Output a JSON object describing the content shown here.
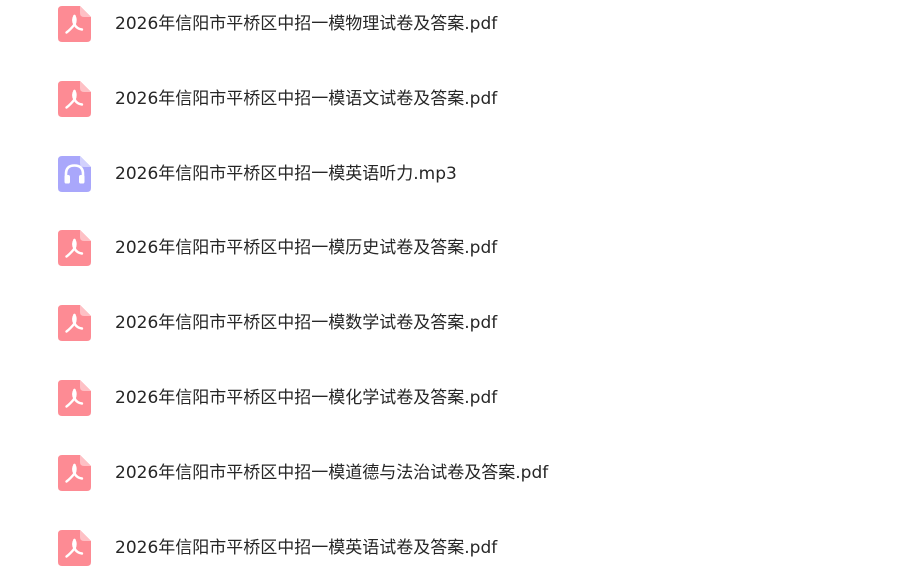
{
  "colors": {
    "pdf_icon": "#fd8b94",
    "audio_icon": "#a9a7fb",
    "text": "#262626",
    "background": "#ffffff"
  },
  "files": [
    {
      "name": "2026年信阳市平桥区中招一模物理试卷及答案.pdf",
      "type": "pdf",
      "icon": "pdf-icon"
    },
    {
      "name": "2026年信阳市平桥区中招一模语文试卷及答案.pdf",
      "type": "pdf",
      "icon": "pdf-icon"
    },
    {
      "name": "2026年信阳市平桥区中招一模英语听力.mp3",
      "type": "mp3",
      "icon": "headphones-icon"
    },
    {
      "name": "2026年信阳市平桥区中招一模历史试卷及答案.pdf",
      "type": "pdf",
      "icon": "pdf-icon"
    },
    {
      "name": "2026年信阳市平桥区中招一模数学试卷及答案.pdf",
      "type": "pdf",
      "icon": "pdf-icon"
    },
    {
      "name": "2026年信阳市平桥区中招一模化学试卷及答案.pdf",
      "type": "pdf",
      "icon": "pdf-icon"
    },
    {
      "name": "2026年信阳市平桥区中招一模道德与法治试卷及答案.pdf",
      "type": "pdf",
      "icon": "pdf-icon"
    },
    {
      "name": "2026年信阳市平桥区中招一模英语试卷及答案.pdf",
      "type": "pdf",
      "icon": "pdf-icon"
    }
  ]
}
